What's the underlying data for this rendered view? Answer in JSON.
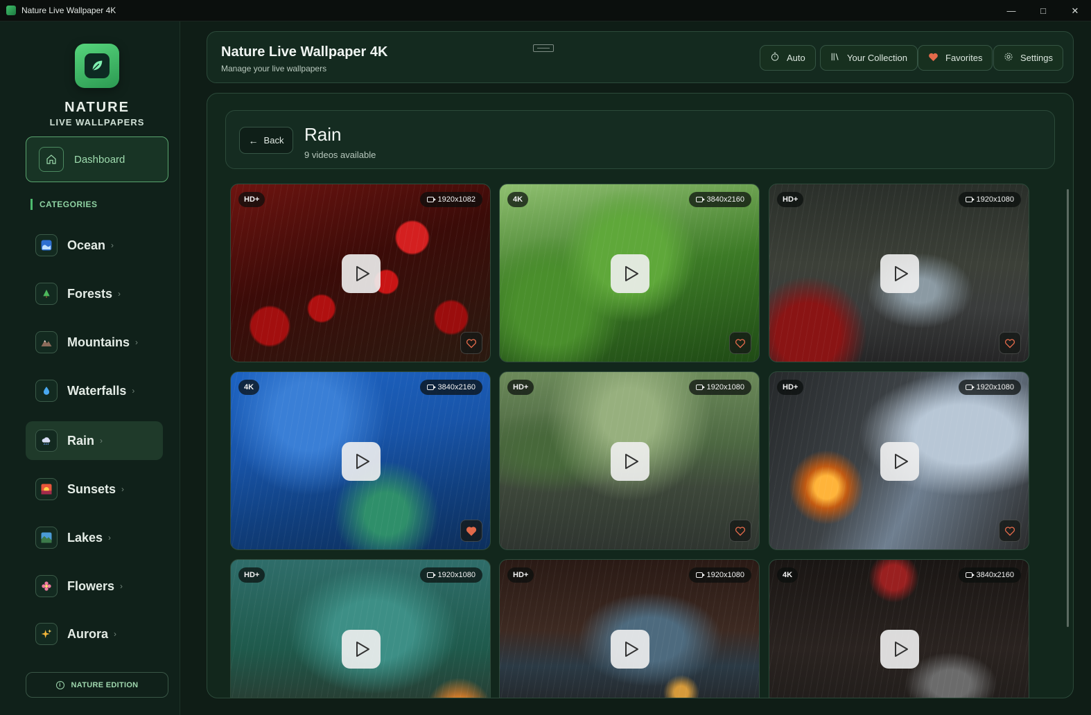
{
  "window": {
    "title": "Nature Live Wallpaper 4K"
  },
  "colors": {
    "accent": "#4dbb6e",
    "background": "#0f1d16",
    "favorite": "#e36a4a"
  },
  "sidebar": {
    "brand_line1": "NATURE",
    "brand_line2": "LIVE WALLPAPERS",
    "dashboard_label": "Dashboard",
    "categories_heading": "CATEGORIES",
    "items": [
      {
        "label": "Ocean",
        "icon": "wave-icon"
      },
      {
        "label": "Forests",
        "icon": "tree-icon"
      },
      {
        "label": "Mountains",
        "icon": "mountain-icon"
      },
      {
        "label": "Waterfalls",
        "icon": "droplet-icon"
      },
      {
        "label": "Rain",
        "icon": "rain-cloud-icon",
        "active": true
      },
      {
        "label": "Sunsets",
        "icon": "sunset-icon"
      },
      {
        "label": "Lakes",
        "icon": "lake-icon"
      },
      {
        "label": "Flowers",
        "icon": "flower-icon"
      },
      {
        "label": "Aurora",
        "icon": "sparkle-icon"
      }
    ],
    "edition_label": "NATURE EDITION"
  },
  "header": {
    "title": "Nature Live Wallpaper 4K",
    "subtitle": "Manage your live wallpapers",
    "buttons": {
      "auto": "Auto",
      "collection": "Your Collection",
      "favorites": "Favorites",
      "settings": "Settings"
    }
  },
  "category": {
    "back_label": "Back",
    "title": "Rain",
    "subtitle": "9 videos available"
  },
  "videos": [
    {
      "quality": "HD+",
      "resolution": "1920x1082",
      "favorite": false,
      "scene": "red-poppies-rain"
    },
    {
      "quality": "4K",
      "resolution": "3840x2160",
      "favorite": false,
      "scene": "rain-on-leaves"
    },
    {
      "quality": "HD+",
      "resolution": "1920x1080",
      "favorite": false,
      "scene": "rainy-forest-road"
    },
    {
      "quality": "4K",
      "resolution": "3840x2160",
      "favorite": true,
      "scene": "blue-rain-forest"
    },
    {
      "quality": "HD+",
      "resolution": "1920x1080",
      "favorite": false,
      "scene": "rain-puddles-meadow"
    },
    {
      "quality": "HD+",
      "resolution": "1920x1080",
      "favorite": false,
      "scene": "stone-fireplace-mountains"
    },
    {
      "quality": "HD+",
      "resolution": "1920x1080",
      "favorite": false,
      "scene": "tent-view-forest"
    },
    {
      "quality": "HD+",
      "resolution": "1920x1080",
      "favorite": false,
      "scene": "cabin-window-rain"
    },
    {
      "quality": "4K",
      "resolution": "3840x2160",
      "favorite": false,
      "scene": "city-night-rain"
    }
  ]
}
